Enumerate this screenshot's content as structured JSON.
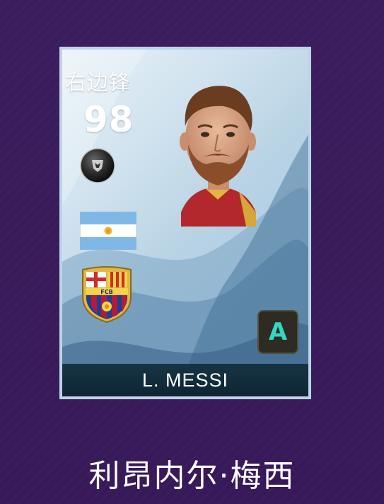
{
  "card": {
    "position": "右边锋",
    "rating": "98",
    "short_name": "L. MESSI",
    "grade": "A",
    "club_crest_letters": "FCB"
  },
  "player": {
    "full_name": "利昂内尔·梅西"
  },
  "icons": {
    "ball_badge": "ball-badge-icon",
    "flag": "argentina-flag-icon",
    "club": "fc-barcelona-crest-icon",
    "portrait": "player-portrait"
  },
  "colors": {
    "background": "#3b1d5e",
    "card_border": "#bcd5e6",
    "name_bar": "#173444",
    "grade_text": "#35d6c3",
    "grade_bg": "#2d2b22"
  }
}
